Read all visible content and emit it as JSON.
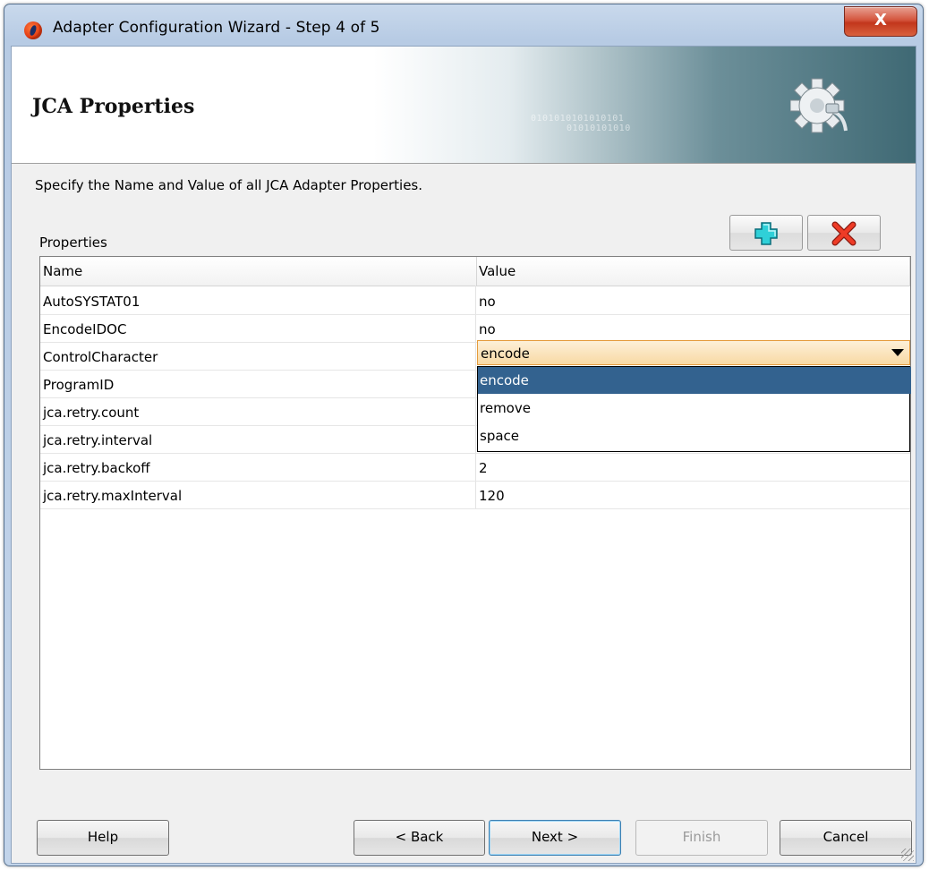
{
  "window": {
    "title": "Adapter Configuration Wizard - Step 4 of 5",
    "close_label": "X"
  },
  "banner": {
    "title": "JCA Properties",
    "binary_line1": "0101010101010101",
    "binary_line2": "01010101010"
  },
  "instructions": "Specify the Name and Value of all JCA Adapter Properties.",
  "properties": {
    "label": "Properties",
    "columns": [
      "Name",
      "Value"
    ],
    "rows": [
      {
        "name": "AutoSYSTAT01",
        "value": "no"
      },
      {
        "name": "EncodeIDOC",
        "value": "no"
      },
      {
        "name": "ControlCharacter",
        "value": "encode"
      },
      {
        "name": "ProgramID",
        "value": ""
      },
      {
        "name": "jca.retry.count",
        "value": ""
      },
      {
        "name": "jca.retry.interval",
        "value": ""
      },
      {
        "name": "jca.retry.backoff",
        "value": "2"
      },
      {
        "name": "jca.retry.maxInterval",
        "value": "120"
      }
    ],
    "dropdown": {
      "selected": "encode",
      "options": [
        "encode",
        "remove",
        "space"
      ]
    }
  },
  "toolbar": {
    "add_icon": "plus-icon",
    "delete_icon": "red-x-icon",
    "add_color": "#22b3c9",
    "delete_color": "#e0281c"
  },
  "buttons": {
    "help": "Help",
    "back": "< Back",
    "next": "Next >",
    "finish": "Finish",
    "cancel": "Cancel"
  }
}
